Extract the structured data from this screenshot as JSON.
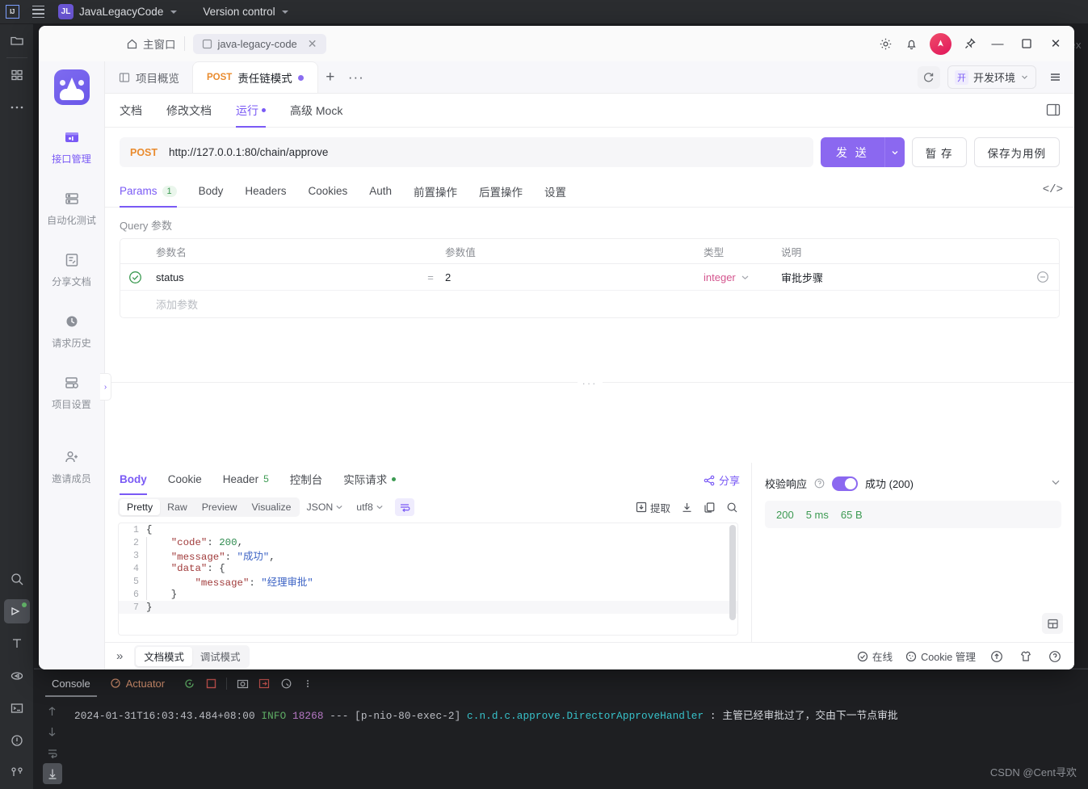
{
  "ide": {
    "logo_text": "IJ",
    "project_badge": "JL",
    "project_name": "JavaLegacyCode",
    "version_control": "Version control",
    "ghost_text_right": "tex",
    "left_strip": [
      {
        "name": "project-files",
        "icon": "folder-icon"
      },
      {
        "name": "structure",
        "icon": "structure-icon"
      },
      {
        "name": "more-tools",
        "icon": "more-icon"
      },
      {
        "name": "search",
        "icon": "search-icon"
      },
      {
        "name": "run",
        "icon": "run-icon"
      },
      {
        "name": "build",
        "icon": "build-icon"
      },
      {
        "name": "debug",
        "icon": "debug-icon"
      },
      {
        "name": "terminal",
        "icon": "terminal-icon"
      },
      {
        "name": "problems",
        "icon": "problems-icon"
      },
      {
        "name": "git",
        "icon": "git-icon"
      }
    ],
    "console": {
      "tab_console": "Console",
      "tab_actuator": "Actuator",
      "log": {
        "timestamp": "2024-01-31T16:03:43.484+08:00",
        "level": "INFO",
        "pid": "18268",
        "dash": "---",
        "thread": "[p-nio-80-exec-2]",
        "logger": "c.n.d.c.approve.DirectorApproveHandler",
        "separator": ":",
        "message": "主管已经审批过了，交由下一节点审批"
      }
    },
    "watermark": "CSDN @Cent寻欢"
  },
  "apifox": {
    "titlebar": {
      "home_label": "主窗口",
      "project_tab": "java-legacy-code",
      "close_x": "✕",
      "minimize": "—",
      "maximize": "▢",
      "close": "✕"
    },
    "sidebar": {
      "items": [
        {
          "label": "接口管理",
          "icon": "api-manage-icon",
          "active": true
        },
        {
          "label": "自动化测试",
          "icon": "auto-test-icon",
          "active": false
        },
        {
          "label": "分享文档",
          "icon": "share-doc-icon",
          "active": false
        },
        {
          "label": "请求历史",
          "icon": "history-icon",
          "active": false
        },
        {
          "label": "项目设置",
          "icon": "project-settings-icon",
          "active": false
        },
        {
          "label": "邀请成员",
          "icon": "invite-member-icon",
          "active": false
        }
      ]
    },
    "tabs": [
      {
        "label": "项目概览",
        "method": "",
        "active": false,
        "dirty": false
      },
      {
        "label": "责任链模式",
        "method": "POST",
        "active": true,
        "dirty": true
      }
    ],
    "tab_add": "+",
    "tab_more": "···",
    "environment": {
      "badge": "开",
      "label": "开发环境"
    },
    "subtabs": [
      {
        "label": "文档",
        "active": false,
        "dot": false
      },
      {
        "label": "修改文档",
        "active": false,
        "dot": false
      },
      {
        "label": "运行",
        "active": true,
        "dot": true
      },
      {
        "label": "高级 Mock",
        "active": false,
        "dot": false
      }
    ],
    "request": {
      "method": "POST",
      "url": "http://127.0.0.1:80/chain/approve",
      "send_label": "发 送",
      "save_draft_label": "暂 存",
      "save_case_label": "保存为用例"
    },
    "request_tabs": [
      {
        "label": "Params",
        "count": "1",
        "active": true
      },
      {
        "label": "Body",
        "count": "",
        "active": false
      },
      {
        "label": "Headers",
        "count": "",
        "active": false
      },
      {
        "label": "Cookies",
        "count": "",
        "active": false
      },
      {
        "label": "Auth",
        "count": "",
        "active": false
      },
      {
        "label": "前置操作",
        "count": "",
        "active": false
      },
      {
        "label": "后置操作",
        "count": "",
        "active": false
      },
      {
        "label": "设置",
        "count": "",
        "active": false
      }
    ],
    "params": {
      "section_label": "Query 参数",
      "headers": [
        "参数名",
        "参数值",
        "类型",
        "说明"
      ],
      "rows": [
        {
          "enabled": true,
          "name": "status",
          "eq": "=",
          "value": "2",
          "type": "integer",
          "desc": "审批步骤"
        }
      ],
      "add_placeholder": "添加参数"
    },
    "response": {
      "tabs": [
        {
          "label": "Body",
          "count": "",
          "active": true,
          "dot": false
        },
        {
          "label": "Cookie",
          "count": "",
          "active": false,
          "dot": false
        },
        {
          "label": "Header",
          "count": "5",
          "active": false,
          "dot": false
        },
        {
          "label": "控制台",
          "count": "",
          "active": false,
          "dot": false
        },
        {
          "label": "实际请求",
          "count": "",
          "active": false,
          "dot": true
        }
      ],
      "share_label": "分享",
      "view_modes": [
        {
          "label": "Pretty",
          "active": true
        },
        {
          "label": "Raw",
          "active": false
        },
        {
          "label": "Preview",
          "active": false
        },
        {
          "label": "Visualize",
          "active": false
        }
      ],
      "format_select": "JSON",
      "encoding_select": "utf8",
      "extract_label": "提取",
      "body_lines": [
        {
          "n": "1",
          "indent": 0,
          "tokens": [
            {
              "t": "{",
              "c": "p"
            }
          ]
        },
        {
          "n": "2",
          "indent": 1,
          "tokens": [
            {
              "t": "\"code\"",
              "c": "k"
            },
            {
              "t": ": ",
              "c": "p"
            },
            {
              "t": "200",
              "c": "n"
            },
            {
              "t": ",",
              "c": "p"
            }
          ]
        },
        {
          "n": "3",
          "indent": 1,
          "tokens": [
            {
              "t": "\"message\"",
              "c": "k"
            },
            {
              "t": ": ",
              "c": "p"
            },
            {
              "t": "\"成功\"",
              "c": "s"
            },
            {
              "t": ",",
              "c": "p"
            }
          ]
        },
        {
          "n": "4",
          "indent": 1,
          "tokens": [
            {
              "t": "\"data\"",
              "c": "k"
            },
            {
              "t": ": ",
              "c": "p"
            },
            {
              "t": "{",
              "c": "p"
            }
          ]
        },
        {
          "n": "5",
          "indent": 2,
          "tokens": [
            {
              "t": "\"message\"",
              "c": "k"
            },
            {
              "t": ": ",
              "c": "p"
            },
            {
              "t": "\"经理审批\"",
              "c": "s"
            }
          ]
        },
        {
          "n": "6",
          "indent": 1,
          "tokens": [
            {
              "t": "}",
              "c": "p"
            }
          ]
        },
        {
          "n": "7",
          "indent": 0,
          "tokens": [
            {
              "t": "}",
              "c": "p"
            }
          ]
        }
      ],
      "validate_label": "校验响应",
      "validate_result": "成功 (200)",
      "stats": {
        "status": "200",
        "time": "5 ms",
        "size": "65 B"
      }
    },
    "statusbar": {
      "expand": "»",
      "modes": [
        {
          "label": "文档模式",
          "active": true
        },
        {
          "label": "调试模式",
          "active": false
        }
      ],
      "online_label": "在线",
      "cookie_label": "Cookie 管理"
    }
  }
}
